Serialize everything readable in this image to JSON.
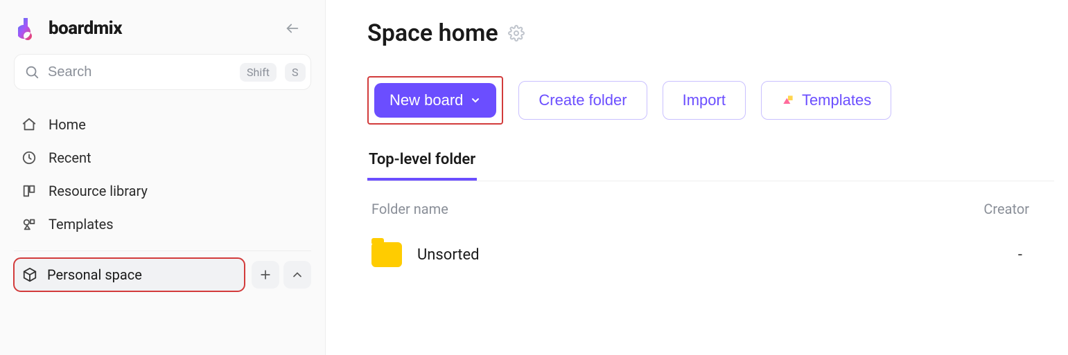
{
  "brand": {
    "name": "boardmix"
  },
  "search": {
    "placeholder": "Search",
    "shortcut_a": "Shift",
    "shortcut_b": "S"
  },
  "nav": {
    "home": "Home",
    "recent": "Recent",
    "resource": "Resource library",
    "templates": "Templates"
  },
  "space": {
    "personal": "Personal space"
  },
  "page": {
    "title": "Space home"
  },
  "actions": {
    "new_board": "New board",
    "create_folder": "Create folder",
    "import": "Import",
    "templates": "Templates"
  },
  "tabs": {
    "top_level": "Top-level folder"
  },
  "table": {
    "col_name": "Folder name",
    "col_creator": "Creator",
    "rows": [
      {
        "name": "Unsorted",
        "creator": "-"
      }
    ]
  }
}
